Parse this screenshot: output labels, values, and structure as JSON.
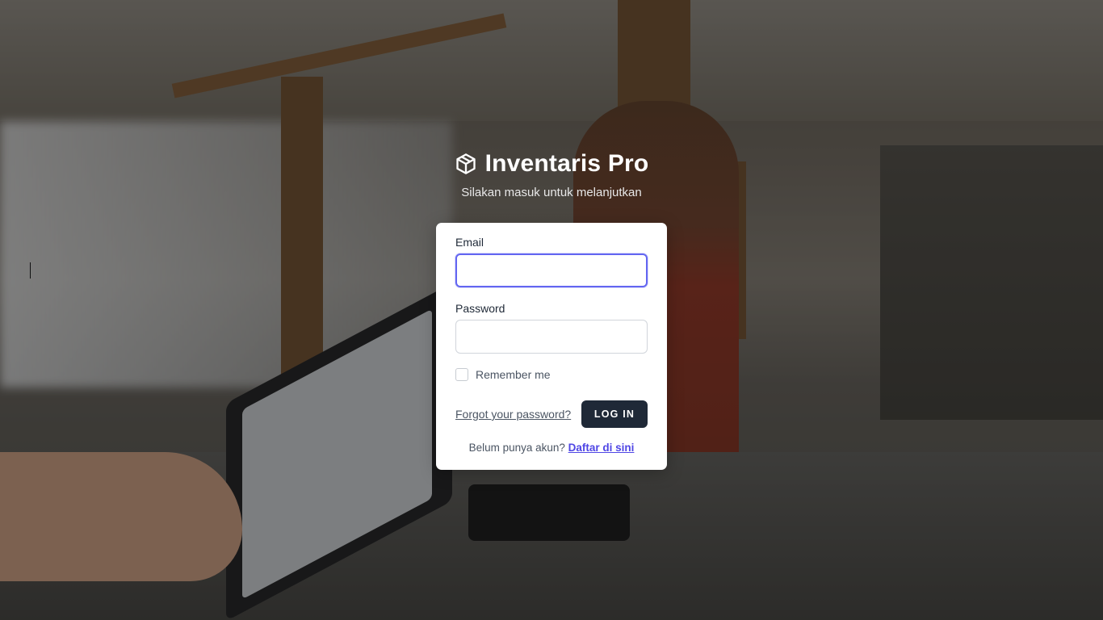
{
  "brand": {
    "title": "Inventaris Pro",
    "subtitle": "Silakan masuk untuk melanjutkan",
    "icon": "cube-icon"
  },
  "form": {
    "email_label": "Email",
    "email_value": "",
    "password_label": "Password",
    "password_value": "",
    "remember_label": "Remember me",
    "remember_checked": false,
    "forgot_link": "Forgot your password?",
    "login_button": "LOG IN",
    "signup_prompt": "Belum punya akun?",
    "signup_link": "Daftar di sini"
  },
  "colors": {
    "accent": "#6366f1",
    "button": "#1f2937",
    "link": "#4f46e5"
  }
}
